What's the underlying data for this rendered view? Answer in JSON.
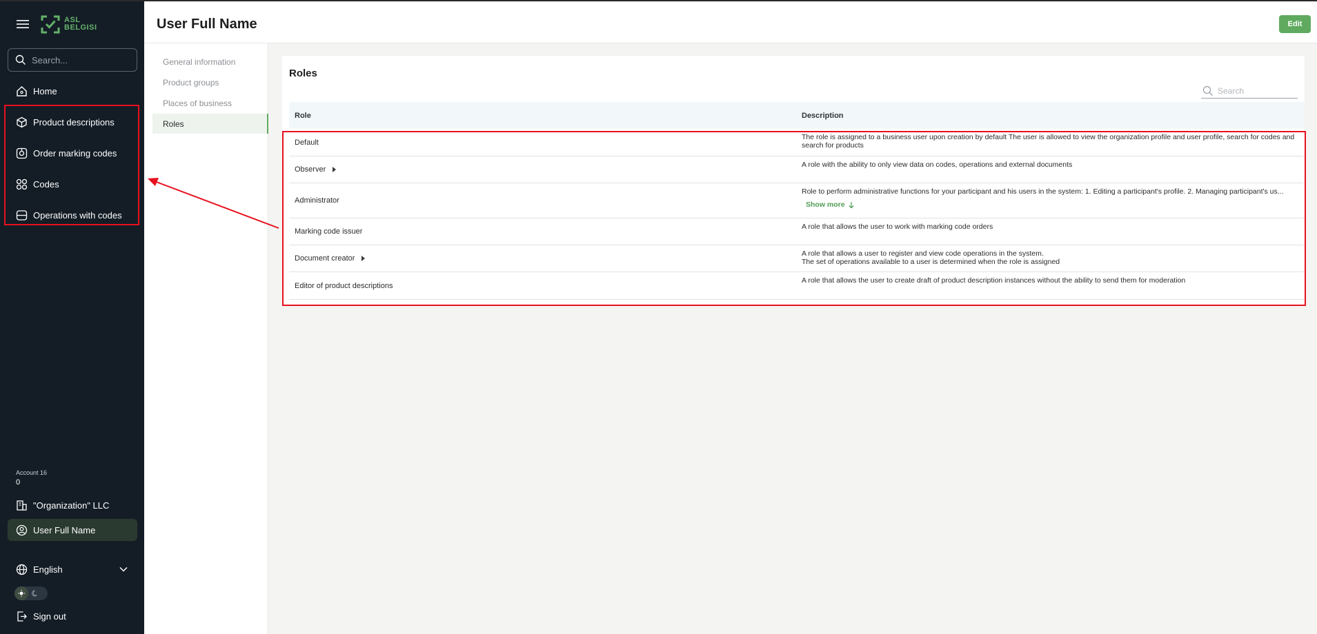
{
  "sidebar": {
    "logo": {
      "line1": "ASL",
      "line2": "BELGISI"
    },
    "search_placeholder": "Search...",
    "items": [
      {
        "label": "Home",
        "icon": "home-icon"
      },
      {
        "label": "Product descriptions",
        "icon": "cube-icon"
      },
      {
        "label": "Order marking codes",
        "icon": "order-codes-icon"
      },
      {
        "label": "Codes",
        "icon": "codes-icon"
      },
      {
        "label": "Operations with codes",
        "icon": "operations-icon"
      }
    ],
    "account_label": "Account 16",
    "account_value": "0",
    "organization": "\"Organization\" LLC",
    "user": "User Full Name",
    "language": "English",
    "sign_out": "Sign out"
  },
  "header": {
    "title": "User Full Name",
    "edit_label": "Edit"
  },
  "subnav": {
    "items": [
      "General information",
      "Product groups",
      "Places of business",
      "Roles"
    ],
    "active": "Roles"
  },
  "roles": {
    "title": "Roles",
    "search_placeholder": "Search",
    "columns": {
      "role": "Role",
      "description": "Description"
    },
    "rows": [
      {
        "role": "Default",
        "expandable": false,
        "description": [
          "The role is assigned to a business user upon creation by default The user is allowed to view the organization profile and user profile, search for codes and",
          "search for products"
        ]
      },
      {
        "role": "Observer",
        "expandable": true,
        "description": [
          "A role with the ability to only view data on codes, operations and external documents"
        ]
      },
      {
        "role": "Administrator",
        "expandable": false,
        "description": [
          "Role to perform administrative functions for your participant and his users in the system: 1. Editing a participant's profile. 2. Managing participant's us..."
        ],
        "show_more": "Show more"
      },
      {
        "role": "Marking code issuer",
        "expandable": false,
        "description": [
          "A role that allows the user to work with marking code orders"
        ]
      },
      {
        "role": "Document creator",
        "expandable": true,
        "description": [
          "A role that allows a user to register and view code operations in the system.",
          "The set of operations available to a user is determined when the role is assigned"
        ]
      },
      {
        "role": "Editor of product descriptions",
        "expandable": false,
        "description": [
          "A role that allows the user to create draft of product description instances without the ability to send them for moderation"
        ]
      }
    ]
  },
  "colors": {
    "sidebar_bg": "#141d26",
    "accent_green": "#5faa5f",
    "annotation_red": "#e8101e"
  }
}
